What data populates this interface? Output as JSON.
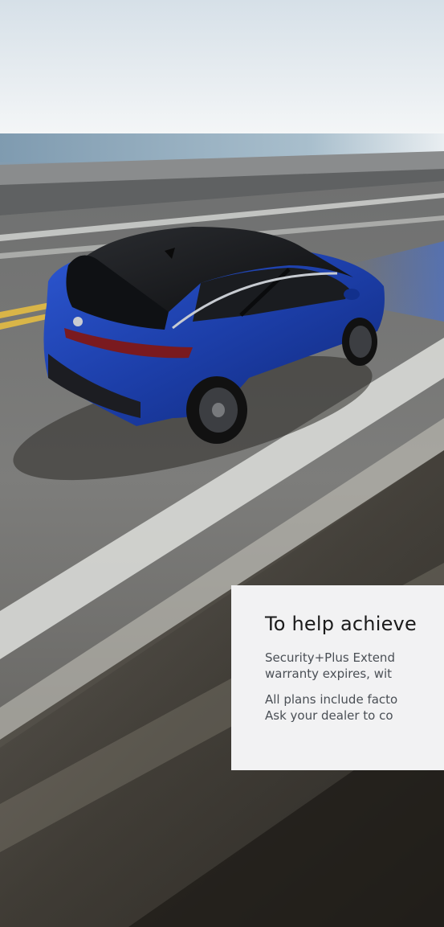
{
  "promo": {
    "title": "To help achieve",
    "paragraph_1_line_1": "Security+Plus Extend",
    "paragraph_1_line_2": "warranty expires, wit",
    "paragraph_2_line_1": "All plans include facto",
    "paragraph_2_line_2": "Ask your dealer to co"
  },
  "colors": {
    "card_background": "#f2f2f3",
    "title_text": "#1b1b1b",
    "body_text": "#4a4f55",
    "vehicle_body": "#1f45b8",
    "vehicle_roof": "#141414"
  }
}
